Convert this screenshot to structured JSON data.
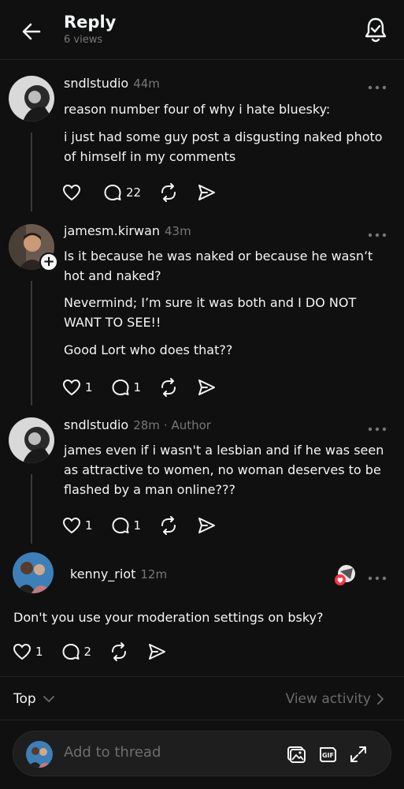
{
  "header": {
    "title": "Reply",
    "views": "6 views"
  },
  "posts": [
    {
      "username": "sndlstudio",
      "time": "44m",
      "author_tag": "",
      "paragraphs": [
        "reason number four of why i hate bluesky:",
        "i just had some guy post a disgusting naked photo of himself in my comments"
      ],
      "like_count": "",
      "reply_count": "22"
    },
    {
      "username": "jamesm.kirwan",
      "time": "43m",
      "author_tag": "",
      "paragraphs": [
        "Is it because he was naked or because he wasn’t hot and naked?",
        "Nevermind; I’m sure it was both and I DO NOT WANT TO SEE!!",
        "Good Lort who does that??"
      ],
      "like_count": "1",
      "reply_count": "1"
    },
    {
      "username": "sndlstudio",
      "time": "28m",
      "author_tag": "· Author",
      "paragraphs": [
        "james even if i wasn't a lesbian and if he was seen as attractive to women, no woman deserves to be flashed by a man online???"
      ],
      "like_count": "1",
      "reply_count": "1"
    }
  ],
  "focused_reply": {
    "username": "kenny_riot",
    "time": "12m",
    "text": "Don't you use your moderation settings on bsky?",
    "like_count": "1",
    "reply_count": "2"
  },
  "sort": {
    "label": "Top",
    "activity_link": "View activity"
  },
  "composer": {
    "placeholder": "Add to thread"
  },
  "colors": {
    "background": "#101010",
    "text": "#f3f5f7",
    "muted": "#777777",
    "like_red": "#ff3040"
  }
}
